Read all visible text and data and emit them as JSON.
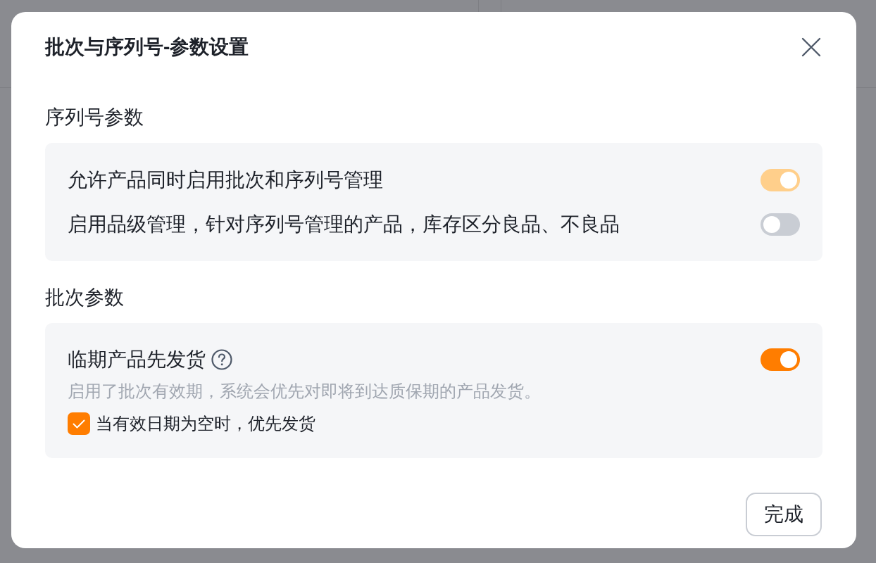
{
  "dialog": {
    "title": "批次与序列号-参数设置",
    "sections": [
      {
        "heading": "序列号参数",
        "settings": [
          {
            "label": "允许产品同时启用批次和序列号管理",
            "help_icon": false,
            "on": true,
            "disabled": true
          },
          {
            "label": "启用品级管理，针对序列号管理的产品，库存区分良品、不良品",
            "help_icon": false,
            "on": false,
            "disabled": false
          }
        ]
      },
      {
        "heading": "批次参数",
        "settings": [
          {
            "label": "临期产品先发货",
            "help_icon": true,
            "on": true,
            "disabled": false,
            "description": "启用了批次有效期，系统会优先对即将到达质保期的产品发货。",
            "option": {
              "label": "当有效日期为空时，优先发货",
              "checked": true
            }
          }
        ]
      }
    ],
    "done_button": {
      "label": "完成"
    }
  }
}
